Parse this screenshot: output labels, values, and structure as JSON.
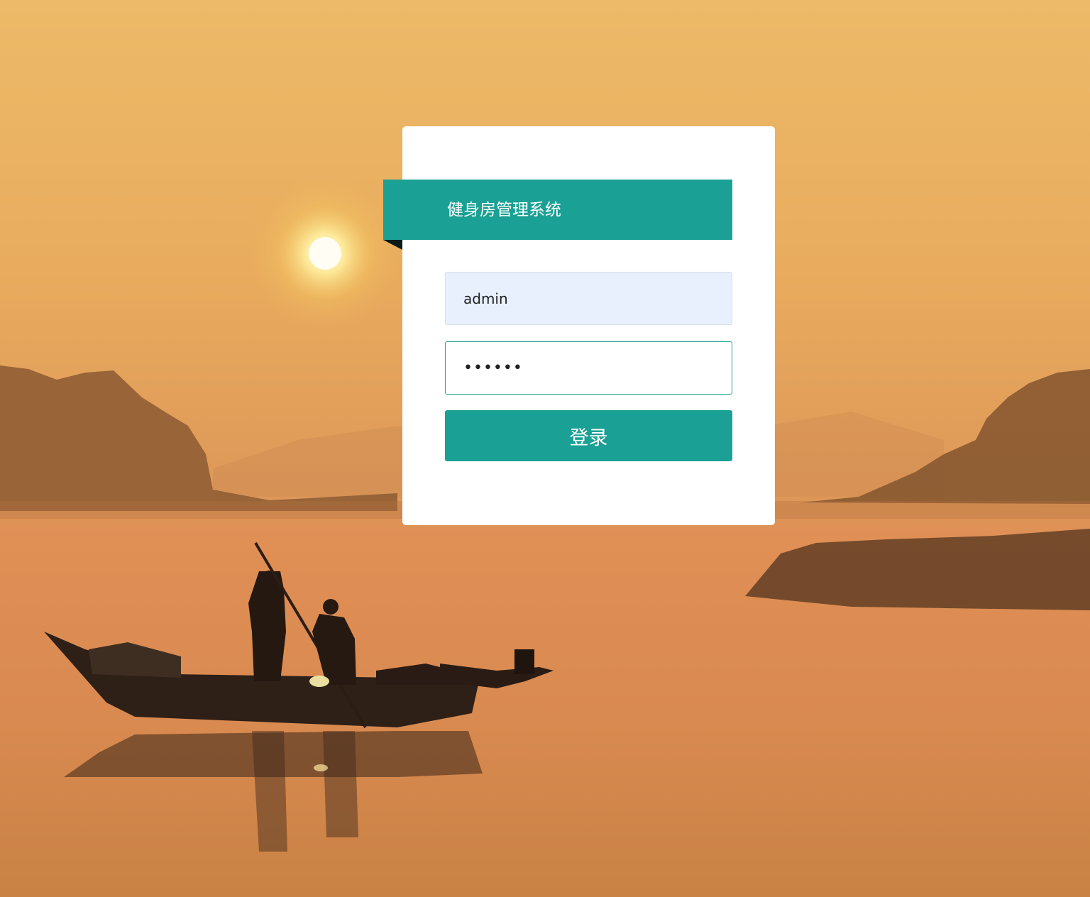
{
  "app": {
    "title": "健身房管理系统"
  },
  "login_form": {
    "username_value": "admin",
    "password_value": "••••••",
    "submit_label": "登录"
  },
  "colors": {
    "accent": "#1aa094",
    "username_bg": "#e8f0fe",
    "card_bg": "#ffffff"
  }
}
